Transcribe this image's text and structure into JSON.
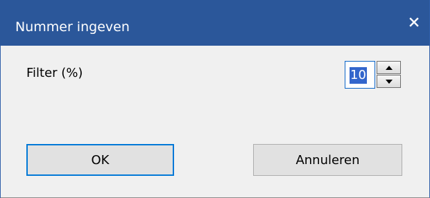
{
  "window": {
    "title": "Nummer ingeven",
    "close_icon": "close-icon"
  },
  "form": {
    "filter_label": "Filter (%)",
    "filter_value": "10",
    "spin_up_icon": "arrow-up-icon",
    "spin_down_icon": "arrow-down-icon"
  },
  "buttons": {
    "ok_label": "OK",
    "cancel_label": "Annuleren"
  },
  "colors": {
    "titlebar": "#2b579a",
    "accent": "#0078d7",
    "selection": "#3366cc",
    "dialog_bg": "#f0f0f0"
  }
}
